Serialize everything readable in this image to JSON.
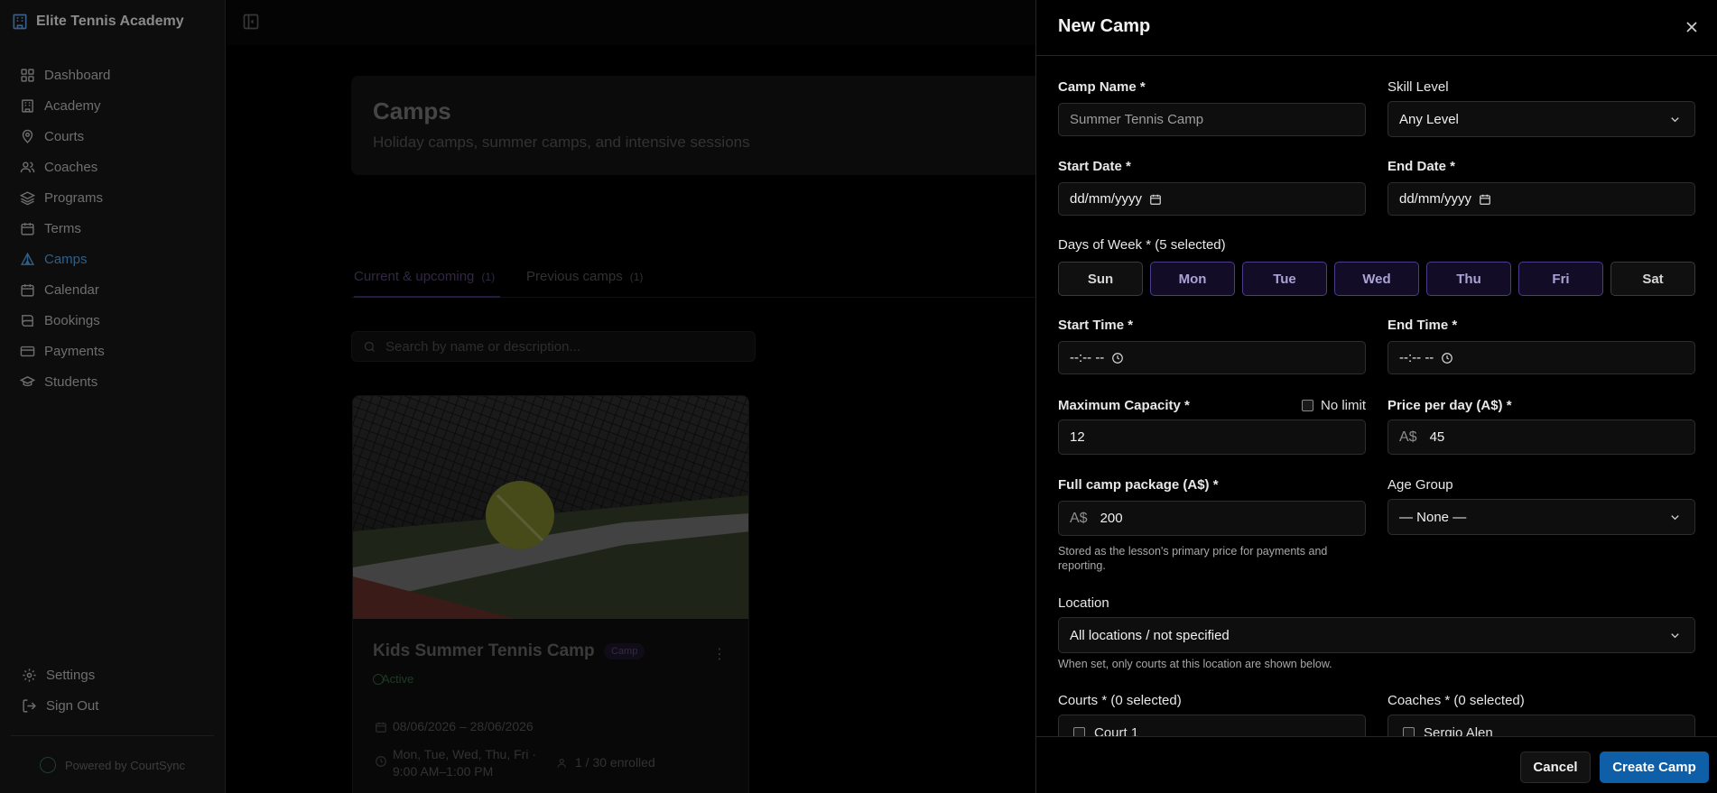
{
  "sidebar": {
    "brand": "Elite Tennis Academy",
    "items": [
      {
        "label": "Dashboard",
        "icon": "dashboard-icon"
      },
      {
        "label": "Academy",
        "icon": "building-icon"
      },
      {
        "label": "Courts",
        "icon": "map-pin-icon"
      },
      {
        "label": "Coaches",
        "icon": "users-icon"
      },
      {
        "label": "Programs",
        "icon": "layers-icon"
      },
      {
        "label": "Terms",
        "icon": "calendar-icon"
      },
      {
        "label": "Camps",
        "icon": "tent-icon"
      },
      {
        "label": "Calendar",
        "icon": "calendar-icon"
      },
      {
        "label": "Bookings",
        "icon": "book-icon"
      },
      {
        "label": "Payments",
        "icon": "credit-card-icon"
      },
      {
        "label": "Students",
        "icon": "graduation-cap-icon"
      }
    ],
    "active_item": "Camps",
    "settings": "Settings",
    "sign_out": "Sign Out",
    "powered_by": "Powered by CourtSync"
  },
  "page": {
    "title": "Camps",
    "subtitle": "Holiday camps, summer camps, and intensive sessions",
    "tabs": [
      {
        "label": "Current & upcoming",
        "count": "(1)"
      },
      {
        "label": "Previous camps",
        "count": "(1)"
      }
    ],
    "search_placeholder": "Search by name or description..."
  },
  "camp_card": {
    "title": "Kids Summer Tennis Camp",
    "badge": "Camp",
    "status": "Active",
    "dates": "08/06/2026 – 28/06/2026",
    "schedule": "Mon, Tue, Wed, Thu, Fri · 9:00 AM–1:00 PM",
    "enrolled": "1 / 30 enrolled"
  },
  "drawer": {
    "title": "New Camp",
    "camp_name_label": "Camp Name *",
    "camp_name_placeholder": "Summer Tennis Camp",
    "skill_level_label": "Skill Level",
    "skill_level_value": "Any Level",
    "start_date_label": "Start Date *",
    "start_date_value": "dd/mm/yyyy",
    "end_date_label": "End Date *",
    "end_date_value": "dd/mm/yyyy",
    "days_label": "Days of Week * (5 selected)",
    "days": [
      {
        "label": "Sun",
        "selected": false
      },
      {
        "label": "Mon",
        "selected": true
      },
      {
        "label": "Tue",
        "selected": true
      },
      {
        "label": "Wed",
        "selected": true
      },
      {
        "label": "Thu",
        "selected": true
      },
      {
        "label": "Fri",
        "selected": true
      },
      {
        "label": "Sat",
        "selected": false
      }
    ],
    "start_time_label": "Start Time *",
    "start_time_value": "--:-- --",
    "end_time_label": "End Time *",
    "end_time_value": "--:-- --",
    "max_capacity_label": "Maximum Capacity *",
    "no_limit_label": "No limit",
    "max_capacity_value": "12",
    "price_per_day_label": "Price per day (A$) *",
    "currency_prefix": "A$",
    "price_per_day_value": "45",
    "full_package_label": "Full camp package (A$) *",
    "full_package_value": "200",
    "full_package_help": "Stored as the lesson's primary price for payments and reporting.",
    "age_group_label": "Age Group",
    "age_group_value": "— None —",
    "location_label": "Location",
    "location_value": "All locations / not specified",
    "location_help": "When set, only courts at this location are shown below.",
    "courts_label": "Courts * (0 selected)",
    "court_option": "Court 1",
    "coaches_label": "Coaches * (0 selected)",
    "coach_option": "Sergio Alen",
    "cancel": "Cancel",
    "create": "Create Camp"
  },
  "colors": {
    "accent": "#0e5fa8",
    "day_selected_border": "#4b3c8e",
    "active_nav": "#2f5f87"
  }
}
